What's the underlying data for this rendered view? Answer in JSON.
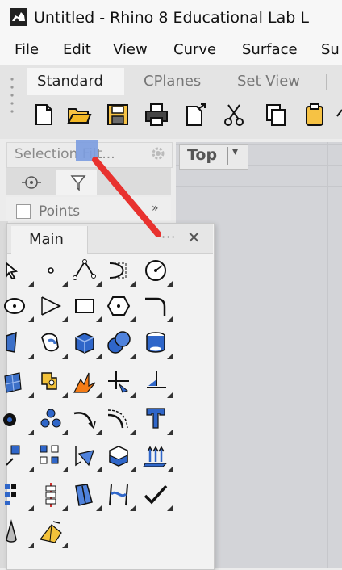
{
  "window": {
    "title": "Untitled - Rhino 8 Educational Lab L"
  },
  "menubar": {
    "items": [
      "File",
      "Edit",
      "View",
      "Curve",
      "Surface",
      "Su"
    ]
  },
  "toolbar": {
    "tabs": [
      "Standard",
      "CPlanes",
      "Set View"
    ],
    "active_tab": "Standard",
    "icons": [
      "new-file-icon",
      "open-folder-icon",
      "save-icon",
      "print-icon",
      "import-icon",
      "cut-icon",
      "copy-icon",
      "paste-icon"
    ]
  },
  "selection_filter": {
    "label": "Selection Filt...",
    "row_label": "Points",
    "expand": "»"
  },
  "viewport": {
    "label": "Top",
    "caret": "▾"
  },
  "main_panel": {
    "title": "Main",
    "options": "···",
    "close": "✕"
  },
  "colors": {
    "accent_blue": "#1a73e8",
    "annotation_red": "#e8322f",
    "viewport_bg": "#d3d4d8"
  }
}
